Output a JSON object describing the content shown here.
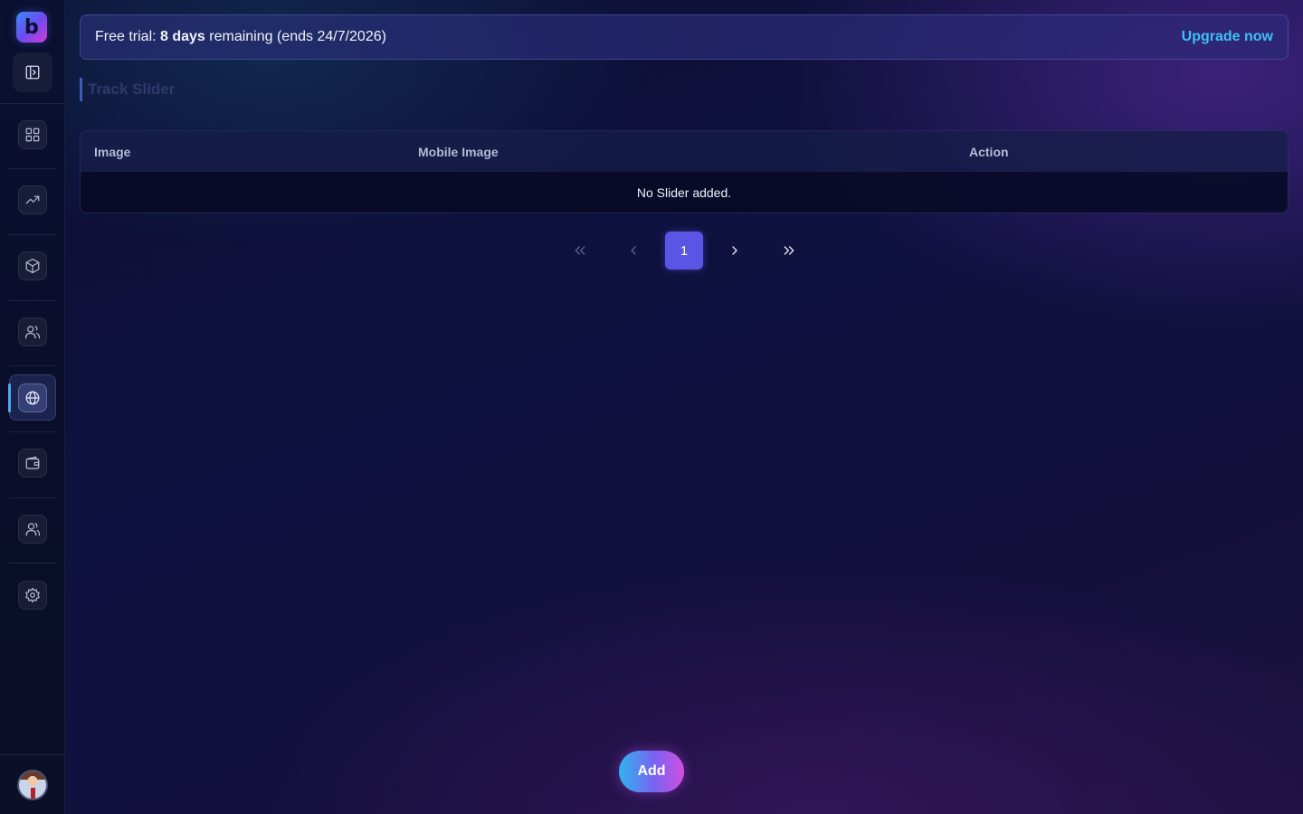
{
  "banner": {
    "prefix": "Free trial: ",
    "days": "8 days",
    "suffix": " remaining (ends 24/7/2026)",
    "upgrade_label": "Upgrade now"
  },
  "page": {
    "title": "Track Slider"
  },
  "table": {
    "columns": [
      "Image",
      "Mobile Image",
      "Action"
    ],
    "empty_message": "No Slider added."
  },
  "pagination": {
    "current_page": "1"
  },
  "actions": {
    "add_label": "Add"
  },
  "sidebar": {
    "items": [
      {
        "icon": "dashboard-icon"
      },
      {
        "icon": "trending-up-icon"
      },
      {
        "icon": "package-icon"
      },
      {
        "icon": "users-icon"
      },
      {
        "icon": "globe-icon",
        "active": true
      },
      {
        "icon": "wallet-icon"
      },
      {
        "icon": "team-icon"
      },
      {
        "icon": "settings-icon"
      }
    ]
  },
  "colors": {
    "accent": "#5b55e6",
    "link": "#3fc0f5",
    "active_indicator": "#4ca8f0"
  }
}
